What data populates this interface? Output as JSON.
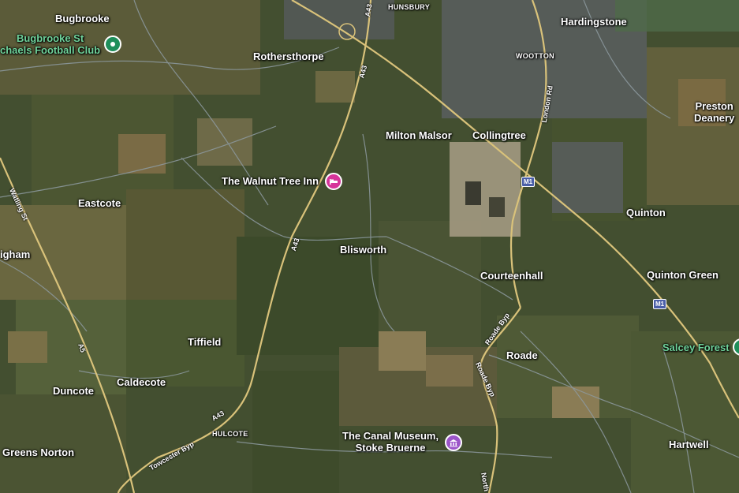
{
  "places": [
    {
      "id": "bugbrooke",
      "text": "Bugbrooke"
    },
    {
      "id": "rothersthorpe",
      "text": "Rothersthorpe"
    },
    {
      "id": "hunsbury",
      "text": "HUNSBURY"
    },
    {
      "id": "hardingstone",
      "text": "Hardingstone"
    },
    {
      "id": "wootton",
      "text": "WOOTTON"
    },
    {
      "id": "preston-deanery",
      "text": "Preston\nDeanery"
    },
    {
      "id": "milton-malsor",
      "text": "Milton Malsor"
    },
    {
      "id": "collingtree",
      "text": "Collingtree"
    },
    {
      "id": "eastcote",
      "text": "Eastcote"
    },
    {
      "id": "quinton",
      "text": "Quinton"
    },
    {
      "id": "gham",
      "text": "igham"
    },
    {
      "id": "blisworth",
      "text": "Blisworth"
    },
    {
      "id": "courteenhall",
      "text": "Courteenhall"
    },
    {
      "id": "quinton-green",
      "text": "Quinton Green"
    },
    {
      "id": "tiffield",
      "text": "Tiffield"
    },
    {
      "id": "roade",
      "text": "Roade"
    },
    {
      "id": "duncote",
      "text": "Duncote"
    },
    {
      "id": "caldecote",
      "text": "Caldecote"
    },
    {
      "id": "hulcote",
      "text": "HULCOTE"
    },
    {
      "id": "greens-norton",
      "text": "Greens Norton"
    },
    {
      "id": "hartwell",
      "text": "Hartwell"
    }
  ],
  "pois": {
    "football": {
      "text": "Bugbrooke St\nchaels Football Club",
      "color": "#1e8e5a"
    },
    "walnut": {
      "text": "The Walnut Tree Inn",
      "color": "#d6349a"
    },
    "canal": {
      "text": "The Canal Museum,\nStoke Bruerne",
      "color": "#9c55c9"
    },
    "salcey": {
      "text": "Salcey Forest",
      "color": "#1e8e5a"
    }
  },
  "roads": {
    "a43_top": "A43",
    "a43_mid": "A43",
    "a43_low": "A43",
    "watling": "Watling St",
    "a5": "A5",
    "london_rd": "London Rd",
    "roade_byp1": "Roade Byp",
    "roade_byp2": "Roade Byp",
    "towcester": "Towcester Byp",
    "north": "North"
  },
  "shields": {
    "m1_top": "M1",
    "m1_right": "M1"
  },
  "colors": {
    "road": "#d9c27a",
    "major_road": "#e8cf7e",
    "minor_road": "#8d9aa0"
  }
}
